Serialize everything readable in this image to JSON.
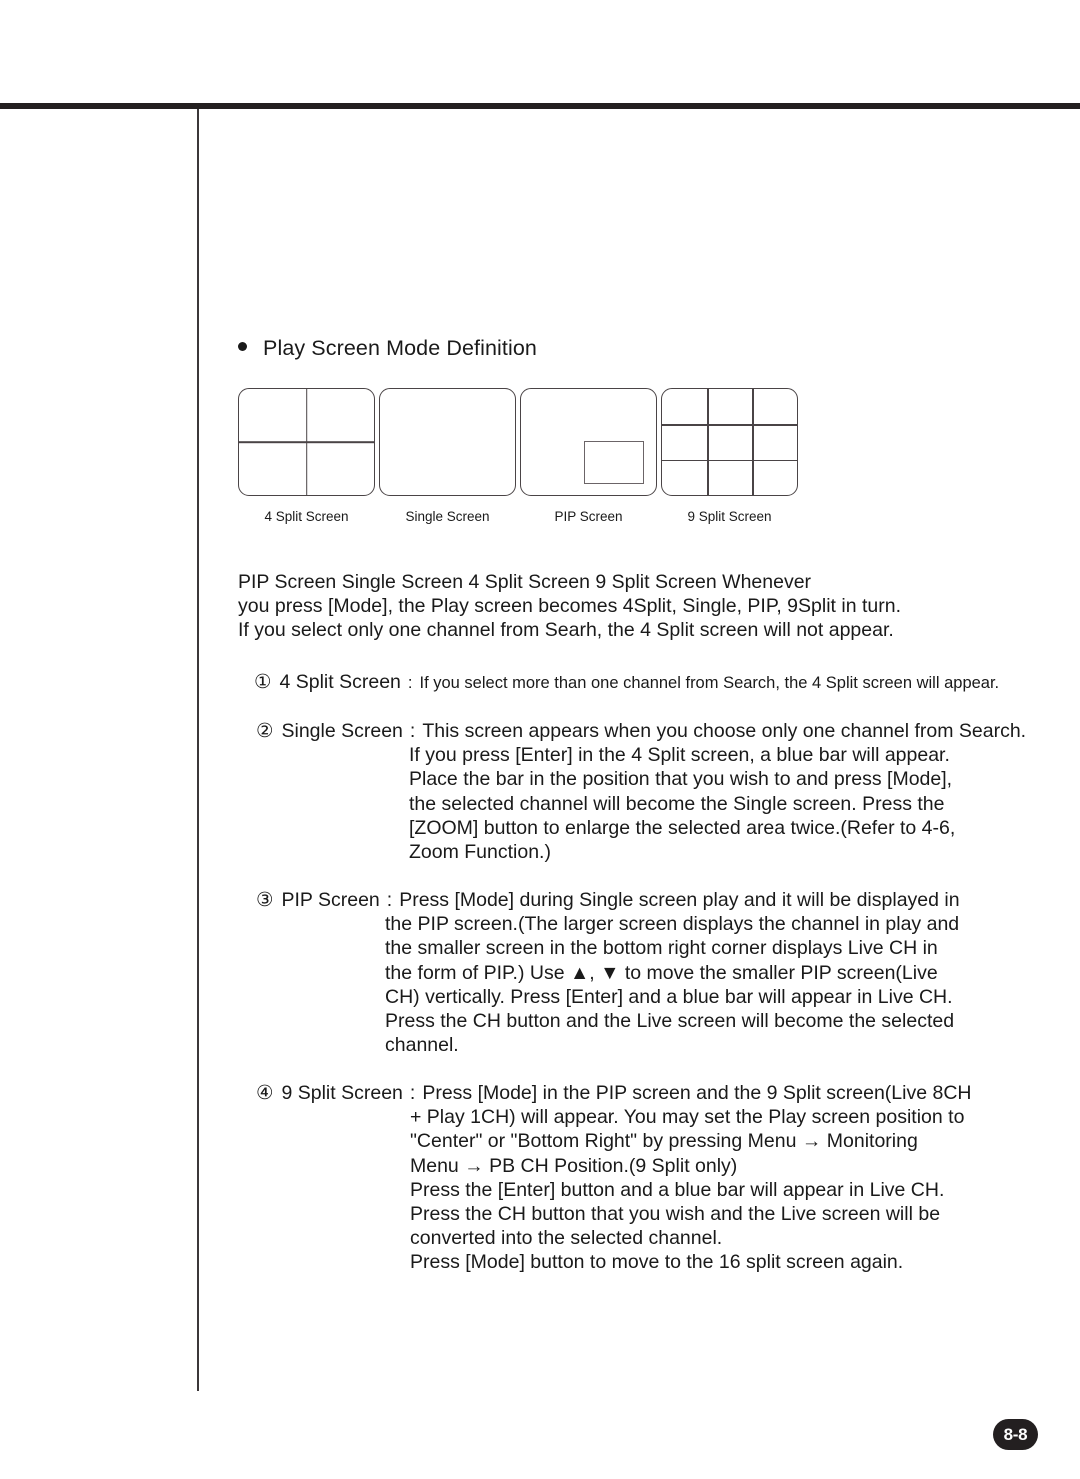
{
  "page": {
    "number_badge": "8-8"
  },
  "section": {
    "bullet_glyph": "●",
    "heading": "Play Screen Mode Definition"
  },
  "diagrams": [
    {
      "kind": "split4",
      "caption": "4 Split Screen"
    },
    {
      "kind": "single",
      "caption": "Single Screen"
    },
    {
      "kind": "pip",
      "caption": "PIP Screen"
    },
    {
      "kind": "split9",
      "caption": "9 Split Screen"
    }
  ],
  "intro": {
    "lines": [
      "PIP Screen Single Screen 4 Split Screen 9 Split Screen Whenever",
      "you press [Mode], the Play screen becomes 4Split, Single, PIP, 9Split in turn.",
      "If you select only one channel from Searh, the 4 Split screen will not appear."
    ]
  },
  "items": [
    {
      "marker": "①",
      "label": "4 Split Screen",
      "colon": ":",
      "first_line": "If you select more than one channel from Search, the 4 Split screen will appear.",
      "cont_lines": []
    },
    {
      "marker": "②",
      "label": "Single Screen",
      "colon": ":",
      "first_line": "This screen appears when you choose only one channel from Search.",
      "cont_lines": [
        "If you press [Enter] in the 4 Split screen, a blue bar will appear.",
        "Place the bar in the position that you wish to and press [Mode],",
        "the selected channel will become the Single screen. Press the",
        "[ZOOM] button to enlarge the selected area twice.(Refer to 4-6,",
        "Zoom Function.)"
      ]
    },
    {
      "marker": "③",
      "label": "PIP Screen",
      "colon": ":",
      "first_line": "Press [Mode] during Single screen play and it will be displayed in",
      "cont_lines": [
        "the PIP screen.(The larger screen displays the channel in play and",
        "the smaller screen in the bottom right corner displays Live CH in",
        "the form of PIP.) Use ▲, ▼ to move the smaller PIP screen(Live",
        "CH) vertically. Press [Enter] and a blue bar will appear in Live CH.",
        "Press the CH button and the Live screen will become the selected",
        "channel."
      ]
    },
    {
      "marker": "④",
      "label": "9 Split Screen",
      "colon": ":",
      "first_line": "Press [Mode] in the PIP screen and the 9 Split screen(Live 8CH",
      "cont_lines": [
        "+ Play 1CH) will appear. You may set the Play screen position to",
        "\"Center\" or \"Bottom Right\" by pressing Menu → Monitoring",
        "Menu → PB CH Position.(9 Split only)",
        "Press the [Enter] button and a blue bar will appear in Live CH.",
        "Press the CH button that you wish and the Live screen will be",
        "converted into the selected channel.",
        "Press [Mode] button to move to the 16 split screen again."
      ]
    }
  ]
}
